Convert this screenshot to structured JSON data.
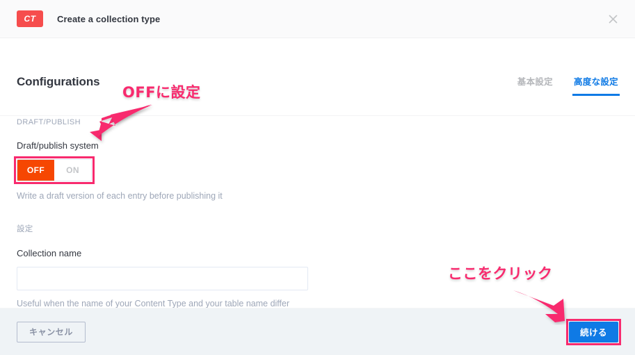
{
  "header": {
    "badge": "CT",
    "title": "Create a collection type",
    "close_icon": "close-icon"
  },
  "section": {
    "title": "Configurations",
    "tabs": [
      {
        "label": "基本設定",
        "active": false
      },
      {
        "label": "高度な設定",
        "active": true
      }
    ]
  },
  "draft_publish": {
    "group_label": "DRAFT/PUBLISH",
    "field_label": "Draft/publish system",
    "toggle": {
      "off_label": "OFF",
      "on_label": "ON",
      "selected": "OFF"
    },
    "help_text": "Write a draft version of each entry before publishing it"
  },
  "settings": {
    "group_label": "設定",
    "collection_name": {
      "label": "Collection name",
      "value": "",
      "placeholder": ""
    },
    "help_text": "Useful when the name of your Content Type and your table name differ"
  },
  "footer": {
    "cancel_label": "キャンセル",
    "continue_label": "続ける"
  },
  "annotations": {
    "set_off": "OFFに設定",
    "click_here": "ここをクリック"
  },
  "colors": {
    "badge_red": "#f64d4d",
    "accent_blue": "#0f7ae5",
    "toggle_off_orange": "#f64702",
    "annotation_pink": "#f82a6e",
    "footer_bg": "#eff3f6",
    "header_bg": "#fafafb",
    "muted_text": "#9ea7b8"
  }
}
